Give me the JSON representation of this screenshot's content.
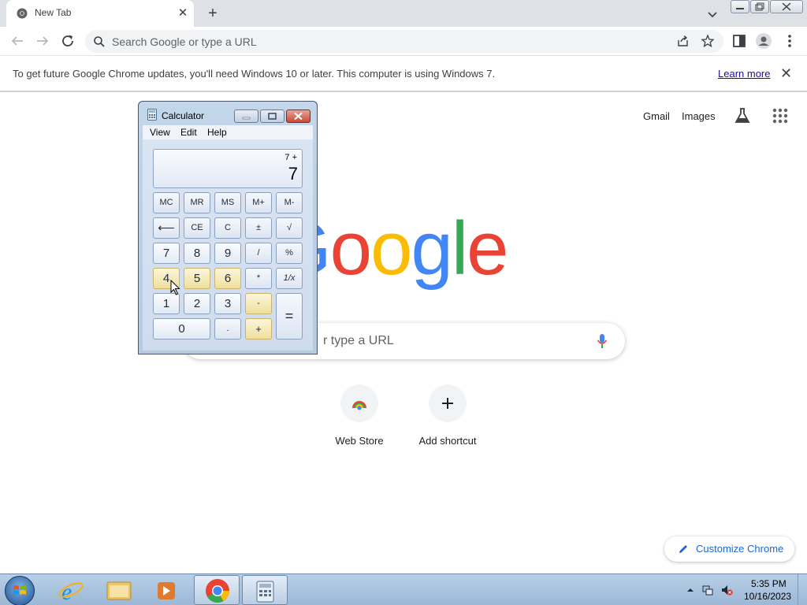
{
  "browser": {
    "tab": {
      "title": "New Tab"
    },
    "omnibox": {
      "placeholder": "Search Google or type a URL"
    },
    "infobar": {
      "message": "To get future Google Chrome updates, you'll need Windows 10 or later. This computer is using Windows 7.",
      "link": "Learn more"
    }
  },
  "ntp": {
    "links": {
      "gmail": "Gmail",
      "images": "Images"
    },
    "search_placeholder": "r type a URL",
    "shortcuts": [
      {
        "label": "Web Store",
        "icon": "web-store-icon"
      },
      {
        "label": "Add shortcut",
        "icon": "plus-icon"
      }
    ],
    "customize_label": "Customize Chrome"
  },
  "calculator": {
    "title": "Calculator",
    "menu": [
      "View",
      "Edit",
      "Help"
    ],
    "display": {
      "expression": "7 +",
      "value": "7"
    },
    "keys": {
      "mc": "MC",
      "mr": "MR",
      "ms": "MS",
      "mplus": "M+",
      "mminus": "M-",
      "back": "⟵",
      "ce": "CE",
      "c": "C",
      "plusminus": "±",
      "sqrt": "√",
      "n7": "7",
      "n8": "8",
      "n9": "9",
      "divide": "/",
      "percent": "%",
      "n4": "4",
      "n5": "5",
      "n6": "6",
      "multiply": "*",
      "reciprocal": "1/x",
      "n1": "1",
      "n2": "2",
      "n3": "3",
      "minus": "-",
      "equals": "=",
      "n0": "0",
      "decimal": ".",
      "plus": "+"
    }
  },
  "taskbar": {
    "clock": {
      "time": "5:35 PM",
      "date": "10/16/2023"
    }
  },
  "colors": {
    "google_blue": "#4285F4",
    "google_red": "#EA4335",
    "google_yellow": "#FBBC05",
    "google_green": "#34A853"
  }
}
